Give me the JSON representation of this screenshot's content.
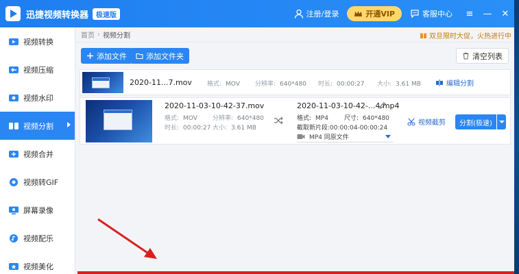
{
  "titlebar": {
    "app_title": "迅捷视频转换器",
    "edition_badge": "极速版",
    "register_login": "注册/登录",
    "vip_label": "开通VIP",
    "service_label": "客服中心",
    "controls": {
      "menu": "≡",
      "minimize": "—",
      "close": "✕"
    }
  },
  "sidebar": {
    "items": [
      {
        "label": "视频转换",
        "icon": "video-convert-icon"
      },
      {
        "label": "视频压缩",
        "icon": "video-compress-icon"
      },
      {
        "label": "视频水印",
        "icon": "video-watermark-icon"
      },
      {
        "label": "视频分割",
        "icon": "video-split-icon",
        "active": true
      },
      {
        "label": "视频合并",
        "icon": "video-merge-icon"
      },
      {
        "label": "视频转GIF",
        "icon": "video-gif-icon"
      },
      {
        "label": "屏幕录像",
        "icon": "screen-record-icon"
      },
      {
        "label": "视频配乐",
        "icon": "video-music-icon"
      },
      {
        "label": "视频美化",
        "icon": "video-beautify-icon"
      }
    ]
  },
  "breadcrumb": {
    "home": "首页",
    "current": "视频分割"
  },
  "promo": {
    "text": "双旦限时大促，火热进行中"
  },
  "toolbar": {
    "add_file": "添加文件",
    "add_folder": "添加文件夹",
    "clear_list": "清空列表"
  },
  "file1": {
    "name": "2020-11...7.mov",
    "format_label": "格式:",
    "format": "MOV",
    "resolution_label": "分辨率:",
    "resolution": "640*480",
    "duration_label": "时长:",
    "duration": "00:00:27",
    "size_label": "大小:",
    "size": "3.61 MB",
    "edit_action": "编辑分割"
  },
  "file2": {
    "name": "2020-11-03-10-42-37.mov",
    "format_label": "格式:",
    "format": "MOV",
    "resolution_label": "分辨率:",
    "resolution": "640*480",
    "duration_label": "时长:",
    "duration": "00:00:27",
    "size_label": "大小:",
    "size": "3.61 MB",
    "output_name": "2020-11-03-10-42-...4.mp4",
    "out_format_label": "格式:",
    "out_format": "MP4",
    "out_size_label": "尺寸:",
    "out_size": "640*480",
    "clip_label": "截取新片段:",
    "clip_range": "00:00:04-00:00:24",
    "select_value": "MP4   同原文件",
    "crop_action": "视频截剪",
    "split_button": "分割(极速)"
  },
  "colors": {
    "accent": "#2a86f2",
    "promo": "#c47a12",
    "annotation": "#d9201f"
  }
}
